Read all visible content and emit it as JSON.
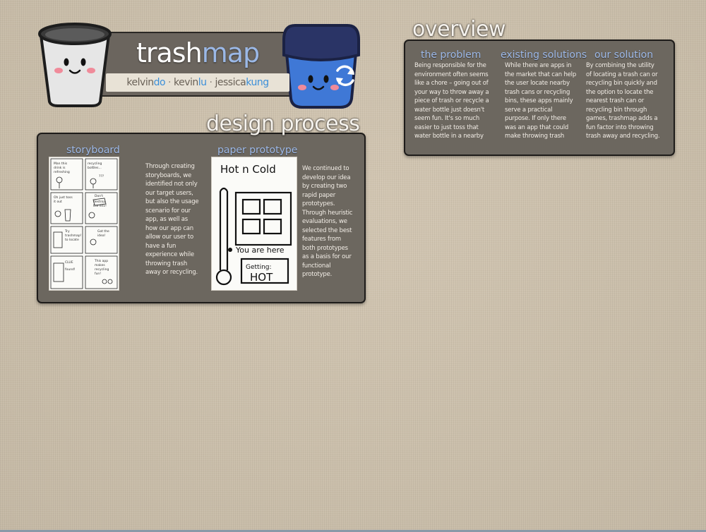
{
  "header": {
    "title_part1": "trash",
    "title_part2": "map",
    "authors": [
      {
        "first": "kelvin",
        "last": "do"
      },
      {
        "first": "kevin",
        "last": "lu"
      },
      {
        "first": "jessica",
        "last": "kung"
      }
    ],
    "separator": "·"
  },
  "design_process": {
    "heading": "design process",
    "storyboard": {
      "title": "storyboard",
      "text": "Through creating storyboards, we identified not only our target users, but also the usage scenario for our app, as well as how our app can allow our user to have a fun experience while throwing trash away or recycling."
    },
    "paper_prototype": {
      "title": "paper prototype",
      "sketch_title": "Hot n Cold",
      "sketch_label_1": "You are here",
      "sketch_label_2a": "Getting:",
      "sketch_label_2b": "HOT",
      "text": "We continued to develop our idea by creating two rapid paper prototypes. Through heuristic evaluations, we selected the best features from both prototypes as a basis for our functional prototype."
    }
  },
  "overview": {
    "heading": "overview",
    "problem": {
      "title": "the problem",
      "text": "Being responsible for the environment often seems like a chore – going out of your way to throw away a piece of trash or recycle a water bottle just doesn't seem fun. It's so much easier to just toss that water bottle in a nearby"
    },
    "existing": {
      "title": "existing solutions",
      "text": "While there are apps in the market that can help the user locate nearby trash cans or recycling bins, these apps mainly serve a practical purpose. If only there was an app that could make throwing trash away"
    },
    "solution": {
      "title": "our solution",
      "text": "By combining the utility of locating a trash can or recycling bin quickly and the option to locate the nearest trash can or recycling bin through games, trashmap adds a fun factor into throwing trash away and recycling."
    }
  },
  "colors": {
    "background": "#cdc1ad",
    "panel": "#6c675f",
    "accent_blue": "#9db9e8",
    "link_blue": "#3b8fd9",
    "bin_blue": "#3f78d6"
  }
}
